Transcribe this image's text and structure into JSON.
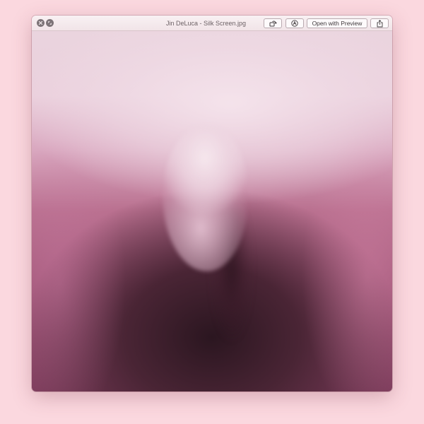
{
  "window": {
    "title": "Jin DeLuca - Silk Screen.jpg",
    "traffic_lights": [
      {
        "name": "close-button",
        "icon": "close-icon"
      },
      {
        "name": "fullscreen-button",
        "icon": "fullscreen-icon"
      }
    ]
  },
  "toolbar": {
    "rotate_icon": "rotate-icon",
    "markup_icon": "markup-icon",
    "open_label": "Open with Preview",
    "share_icon": "share-icon"
  },
  "preview": {
    "image_subject": "blurred pink silk fabric photograph"
  },
  "colors": {
    "background": "#fbd8df",
    "titlebar": "#f3e7ea",
    "accent_pink": "#b9708f",
    "dark_shadow": "#2b1620"
  }
}
